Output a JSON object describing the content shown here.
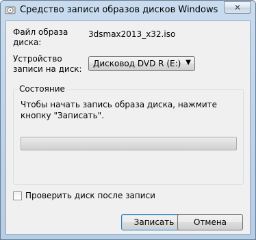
{
  "window": {
    "title": "Средство записи образов дисков Windows",
    "close_glyph": "✕"
  },
  "form": {
    "file_label": "Файл образа диска:",
    "file_value": "3dsmax2013_x32.iso",
    "device_label": "Устройство записи на диск:",
    "device_value": "Дисковод DVD R (E:)",
    "device_arrow": "▼"
  },
  "status": {
    "title": "Состояние",
    "message": "Чтобы начать запись образа диска, нажмите кнопку \"Записать\".",
    "progress": 0
  },
  "verify": {
    "label": "Проверить диск после записи",
    "checked": false
  },
  "buttons": {
    "burn": "Записать",
    "cancel": "Отмена"
  },
  "icons": {
    "app": "disc-burner-icon",
    "close": "close-icon",
    "dropdown": "chevron-down-icon"
  }
}
